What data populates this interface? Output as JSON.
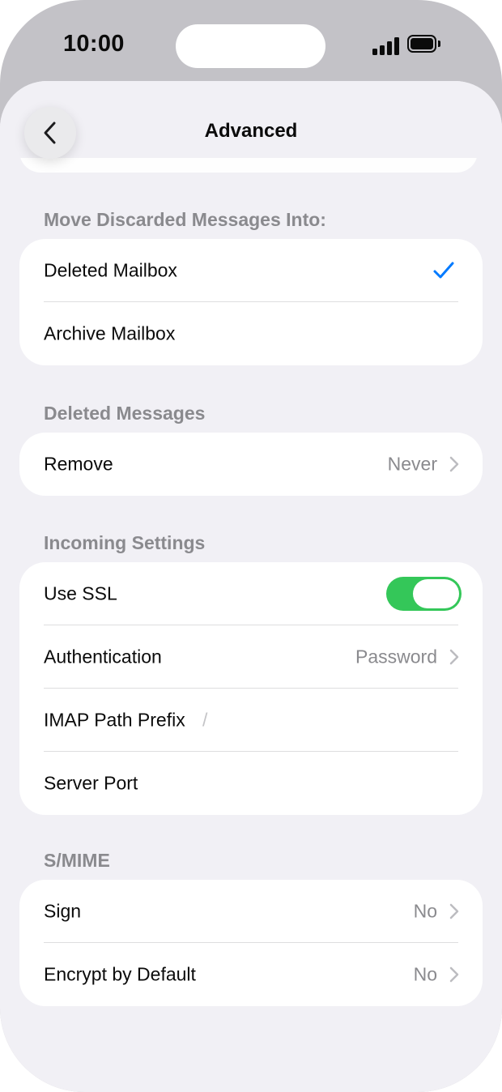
{
  "status_bar": {
    "time": "10:00"
  },
  "nav": {
    "title": "Advanced"
  },
  "sections": {
    "discard": {
      "header": "Move Discarded Messages Into:",
      "deleted_mailbox": "Deleted Mailbox",
      "archive_mailbox": "Archive Mailbox",
      "selected": "Deleted Mailbox"
    },
    "deleted": {
      "header": "Deleted Messages",
      "remove_label": "Remove",
      "remove_value": "Never"
    },
    "incoming": {
      "header": "Incoming Settings",
      "use_ssl_label": "Use SSL",
      "use_ssl_on": true,
      "auth_label": "Authentication",
      "auth_value": "Password",
      "imap_prefix_label": "IMAP Path Prefix",
      "imap_prefix_value": "/",
      "server_port_label": "Server Port"
    },
    "smime": {
      "header": "S/MIME",
      "sign_label": "Sign",
      "sign_value": "No",
      "encrypt_label": "Encrypt by Default",
      "encrypt_value": "No"
    }
  },
  "colors": {
    "accent": "#007aff",
    "toggle_on": "#34c759",
    "background": "#f1f0f5"
  }
}
